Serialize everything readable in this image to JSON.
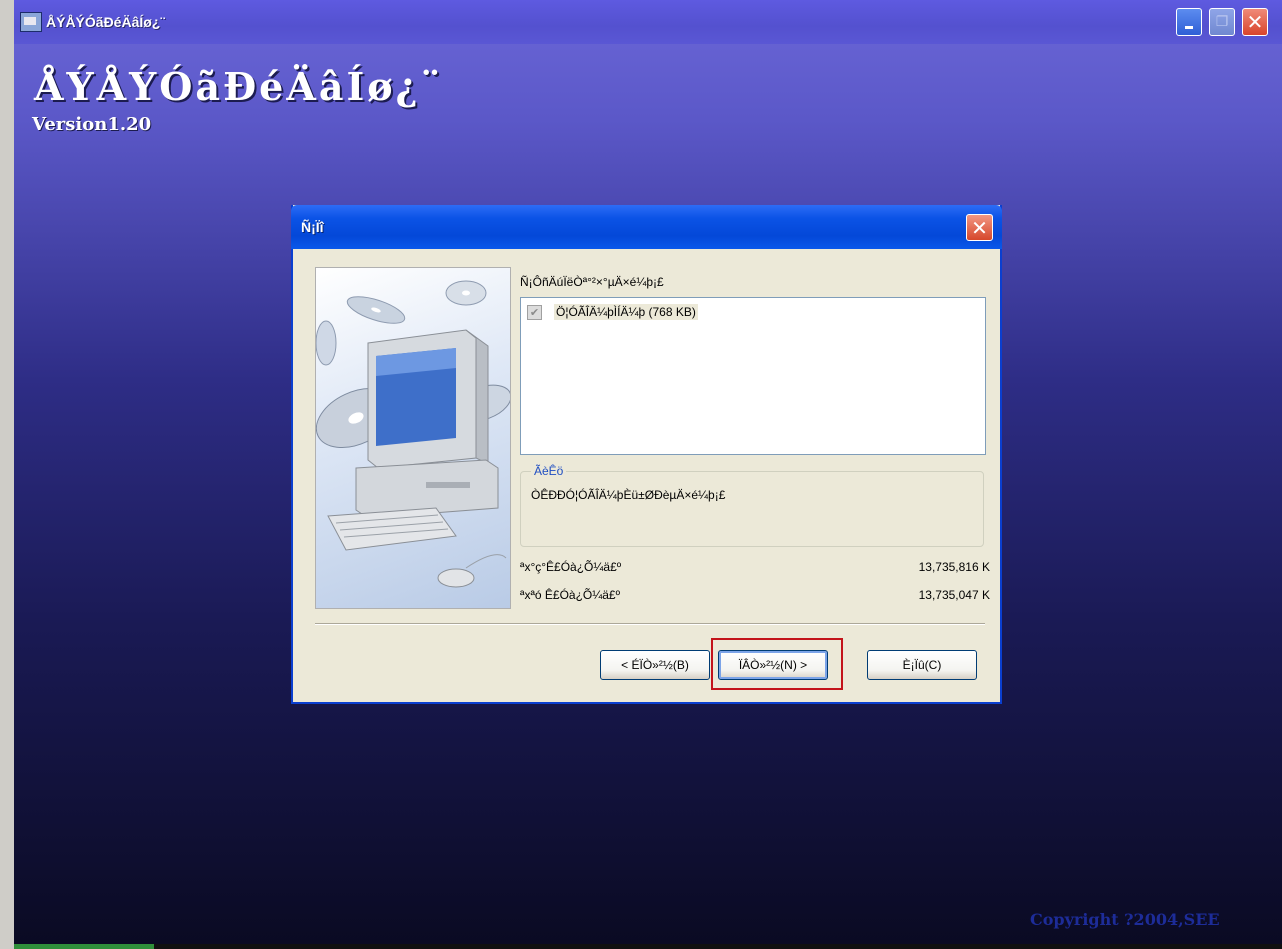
{
  "window": {
    "title": "ÅÝÅÝÓãÐéÄâÍø¿¨"
  },
  "app": {
    "big_title": "ÅÝÅÝÓãÐéÄâÍø¿¨",
    "version": "Version1.20",
    "copyright": "Copyright ?2004,SEE"
  },
  "dialog": {
    "title": "Ñ¡Ïî",
    "instruction": "Ñ¡ÔñÄúÏëÒª°²×°µÄ×é¼þ¡£",
    "components": [
      {
        "label": "Ö¦ÓÃÎÄ¼þÌÍÄ¼þ (768 KB)",
        "checked": true,
        "disabled": true
      }
    ],
    "group": {
      "legend": "ÃèÊö",
      "description": "ÒÊÐÐÓ¦ÓÃÎÄ¼þÈü±ØÐèµÄ×é¼þ¡£"
    },
    "space_required_label": "ªx°ç°Ê£Óà¿Õ¼ä£º",
    "space_required_value": "13,735,816 K",
    "space_available_label": "ªxªó Ê£Óà¿Õ¼ä£º",
    "space_available_value": "13,735,047 K",
    "buttons": {
      "back": "< ÉÏÒ»²½(B)",
      "next": "ÏÂÒ»²½(N) >",
      "cancel": "È¡Ïû(C)"
    }
  },
  "colors": {
    "dialog_title": "#0b53e6",
    "highlight": "#c3141b",
    "background_top": "#6b67d8",
    "background_bottom": "#0a0a22"
  }
}
